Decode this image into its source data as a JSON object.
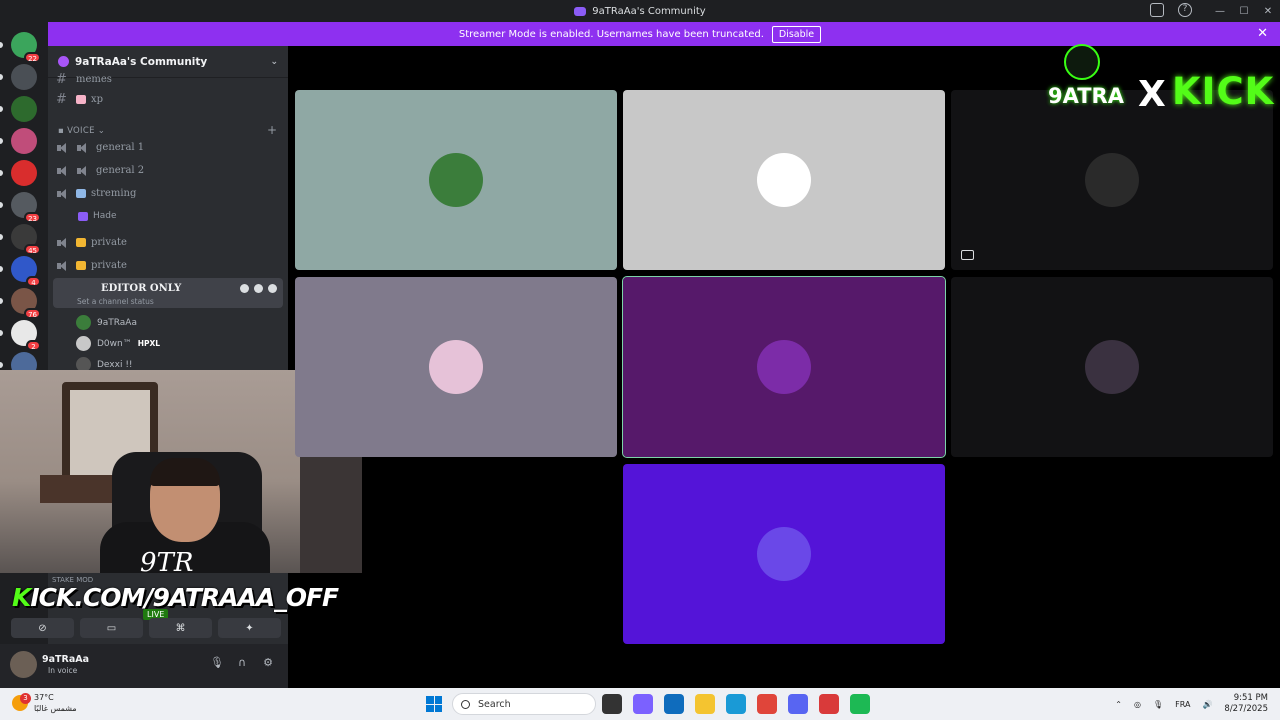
{
  "window": {
    "title": "9aTRaAa's Community"
  },
  "banner": {
    "text": "Streamer Mode is enabled. Usernames have been truncated.",
    "button": "Disable"
  },
  "guilds": [
    {
      "color": "#3ba55c",
      "badge": "22"
    },
    {
      "color": "#4a4f55",
      "badge": ""
    },
    {
      "color": "#2d6a2d",
      "badge": ""
    },
    {
      "color": "#c04d7a",
      "badge": ""
    },
    {
      "color": "#d92d2d",
      "badge": ""
    },
    {
      "color": "#555a60",
      "badge": "23"
    },
    {
      "color": "#3a3a3a",
      "badge": "45"
    },
    {
      "color": "#3058c9",
      "badge": "4"
    },
    {
      "color": "#7a5547",
      "badge": "76"
    },
    {
      "color": "#e8e8e8",
      "badge": "2"
    },
    {
      "color": "#4d6a9a",
      "badge": ""
    }
  ],
  "server": {
    "name": "9aTRaAa's Community"
  },
  "channels": {
    "text_partial": "memes",
    "text_xp": "xp",
    "voice_category": "VOICE",
    "voice": [
      "general 1",
      "general 2",
      "streming",
      "private",
      "private"
    ],
    "sub_hade": "Hade",
    "active": {
      "name": "EDITOR ONLY",
      "status": "Set a channel status"
    },
    "members": [
      "9aTRaAa",
      "D0wn™",
      "Dexxi !!"
    ],
    "member_tag": "HPXL",
    "stage_label": "STAKE MOD"
  },
  "overlay": {
    "signature": "9TR",
    "kick_url": "KICK.COM/9ATRAAA_OFF",
    "kick_k": "K",
    "live": "LIVE",
    "logo_left": "9ATRA",
    "logo_x": "X",
    "logo_right": "KICK"
  },
  "user": {
    "name": "9aTRaAa",
    "status": "In voice"
  },
  "tiles": [
    {
      "bg": "#8fa8a4",
      "avatar": "#3b7d3b"
    },
    {
      "bg": "#c8c8c8",
      "avatar": "#ffffff"
    },
    {
      "bg": "#121214",
      "avatar": "#2a2a2a"
    },
    {
      "bg": "#807a8c",
      "avatar": "#e6c2d8"
    },
    {
      "bg": "#56196a",
      "avatar": "#7c2ca8"
    },
    {
      "bg": "#121214",
      "avatar": "#3a3140"
    },
    {
      "bg": "#5414d8",
      "avatar": "#6a48e8"
    }
  ],
  "taskbar": {
    "temp": "37°C",
    "weather_text": "مشمس غالبًا",
    "search": "Search",
    "lang": "FRA",
    "time": "9:51 PM",
    "date": "8/27/2025",
    "badge": "3"
  }
}
